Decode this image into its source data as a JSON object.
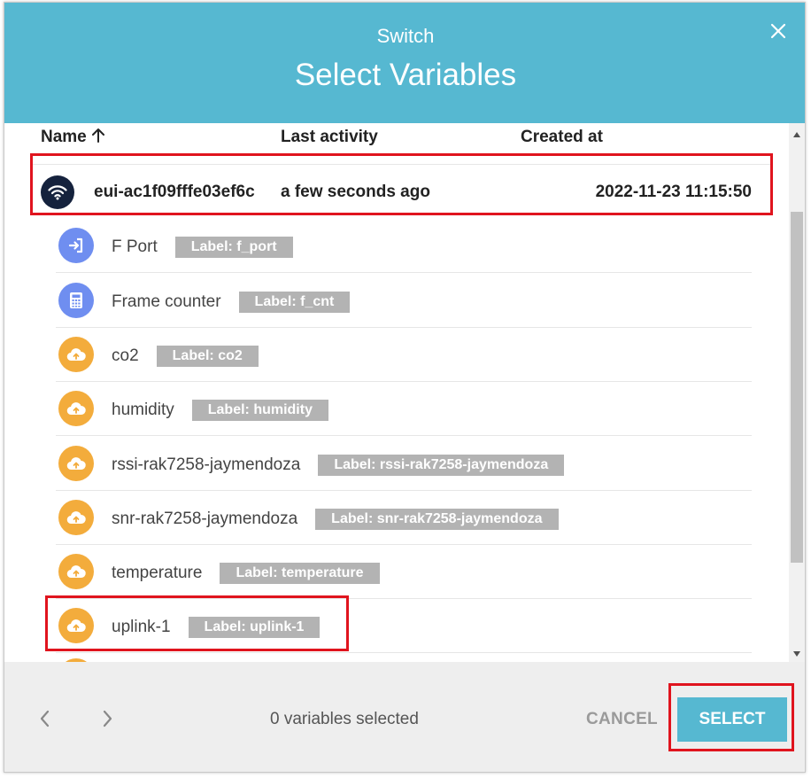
{
  "header": {
    "subtitle": "Switch",
    "title": "Select Variables"
  },
  "columns": {
    "name": "Name",
    "last_activity": "Last activity",
    "created_at": "Created at"
  },
  "device": {
    "name": "eui-ac1f09fffe03ef6c",
    "last_activity": "a few seconds ago",
    "created_at": "2022-11-23 11:15:50",
    "icon": "wifi-icon"
  },
  "variables": [
    {
      "name": "F Port",
      "label": "Label: f_port",
      "icon": "login-icon",
      "color": "#6f8ef0"
    },
    {
      "name": "Frame counter",
      "label": "Label: f_cnt",
      "icon": "calculator-icon",
      "color": "#6f8ef0"
    },
    {
      "name": "co2",
      "label": "Label: co2",
      "icon": "cloud-upload-icon",
      "color": "#f3ac3c"
    },
    {
      "name": "humidity",
      "label": "Label: humidity",
      "icon": "cloud-upload-icon",
      "color": "#f3ac3c"
    },
    {
      "name": "rssi-rak7258-jaymendoza",
      "label": "Label: rssi-rak7258-jaymendoza",
      "icon": "cloud-upload-icon",
      "color": "#f3ac3c"
    },
    {
      "name": "snr-rak7258-jaymendoza",
      "label": "Label: snr-rak7258-jaymendoza",
      "icon": "cloud-upload-icon",
      "color": "#f3ac3c"
    },
    {
      "name": "temperature",
      "label": "Label: temperature",
      "icon": "cloud-upload-icon",
      "color": "#f3ac3c"
    },
    {
      "name": "uplink-1",
      "label": "Label: uplink-1",
      "icon": "cloud-upload-icon",
      "color": "#f3ac3c"
    }
  ],
  "footer": {
    "selected_count": "0 variables selected",
    "cancel_label": "CANCEL",
    "select_label": "SELECT"
  },
  "colors": {
    "header": "#56b8d1",
    "highlight": "#e0141e",
    "label_badge": "#b3b3b3"
  }
}
